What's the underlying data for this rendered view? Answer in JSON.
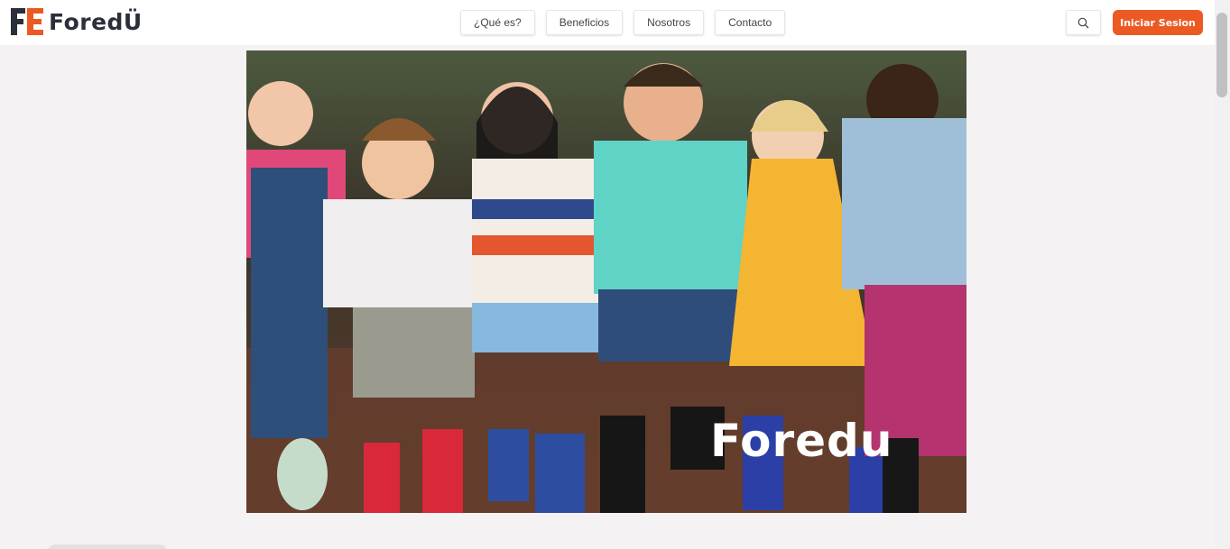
{
  "brand": {
    "name": "ForedÜ",
    "mark": "FE",
    "colors": {
      "primary": "#ec5a24",
      "dark": "#2b2f3a"
    }
  },
  "nav": {
    "items": [
      {
        "label": "¿Qué es?"
      },
      {
        "label": "Beneficios"
      },
      {
        "label": "Nosotros"
      },
      {
        "label": "Contacto"
      }
    ]
  },
  "header": {
    "search_icon": "search-icon",
    "login_label": "Iniciar Sesion"
  },
  "hero": {
    "title": "Foredu",
    "image": "children-photo"
  }
}
